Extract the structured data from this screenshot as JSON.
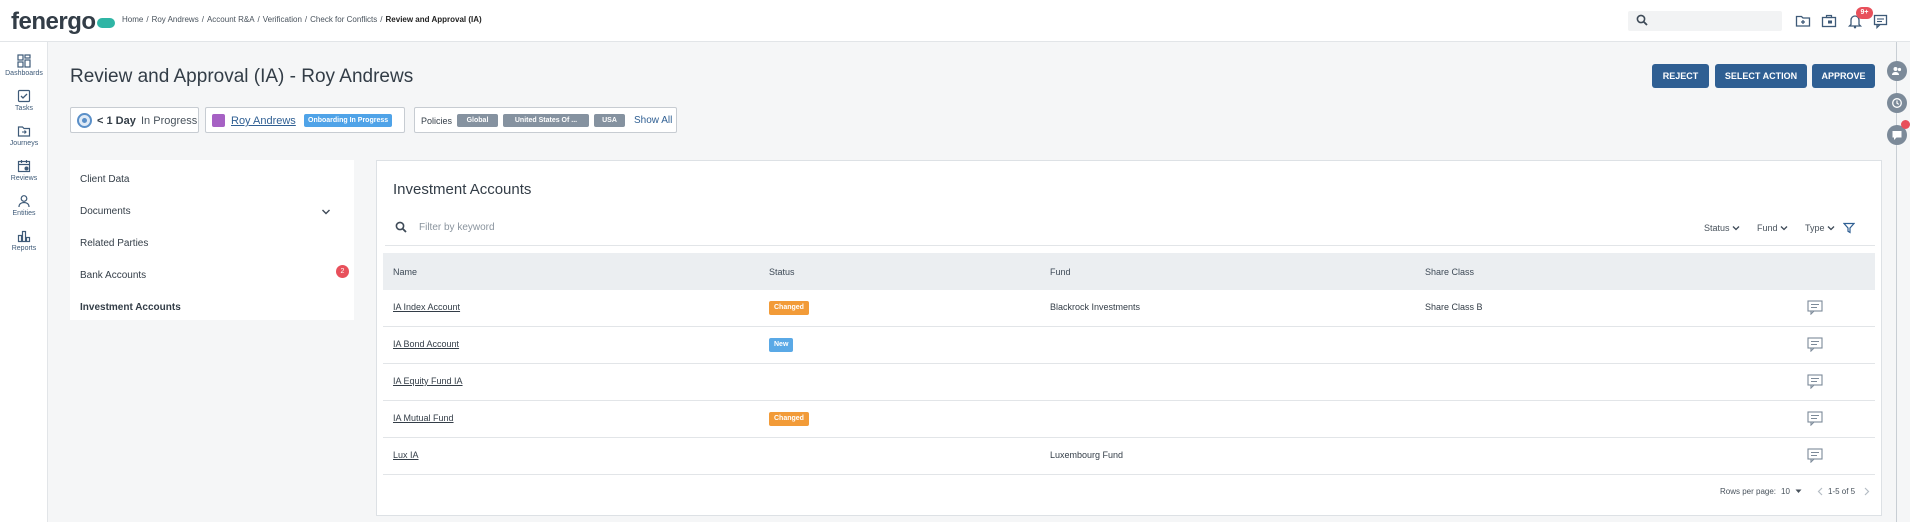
{
  "brand": {
    "logo_text": "fenergo",
    "accent": "#2fb5a5"
  },
  "breadcrumb": [
    {
      "label": "Home"
    },
    {
      "label": "Roy Andrews"
    },
    {
      "label": "Account R&A"
    },
    {
      "label": "Verification"
    },
    {
      "label": "Check for Conflicts"
    },
    {
      "label": "Review and Approval (IA)",
      "current": true
    }
  ],
  "breadcrumb_sep": "/",
  "topbar": {
    "search_placeholder": "",
    "notification_count": "9+",
    "icons": [
      "search-icon",
      "folder-add-icon",
      "briefcase-icon",
      "bell-icon",
      "chat-icon"
    ]
  },
  "nav": [
    {
      "label": "Dashboards",
      "icon": "grid-icon"
    },
    {
      "label": "Tasks",
      "icon": "checkbox-icon"
    },
    {
      "label": "Journeys",
      "icon": "journey-icon"
    },
    {
      "label": "Reviews",
      "icon": "calendar-icon"
    },
    {
      "label": "Entities",
      "icon": "person-icon"
    },
    {
      "label": "Reports",
      "icon": "bar-chart-icon"
    }
  ],
  "page": {
    "title": "Review and Approval (IA) - Roy Andrews",
    "actions": {
      "reject": "REJECT",
      "select_action": "SELECT ACTION",
      "approve": "APPROVE"
    },
    "action_color": "#2f5f93"
  },
  "info": {
    "duration": "< 1 Day",
    "duration_status": "In Progress",
    "entity_name": "Roy Andrews",
    "entity_status": "Onboarding In Progress",
    "entity_status_color": "#4fa3e8",
    "policies_label": "Policies",
    "policies": [
      "Global",
      "United States Of ...",
      "USA"
    ],
    "show_all": "Show All"
  },
  "side_menu": {
    "items": [
      {
        "label": "Client Data"
      },
      {
        "label": "Documents",
        "expandable": true
      },
      {
        "label": "Related Parties"
      },
      {
        "label": "Bank Accounts",
        "badge": "2"
      },
      {
        "label": "Investment Accounts",
        "active": true
      }
    ]
  },
  "investment": {
    "title": "Investment Accounts",
    "filter_placeholder": "Filter by keyword",
    "dropdowns": {
      "status": "Status",
      "fund": "Fund",
      "type": "Type"
    },
    "columns": {
      "name": "Name",
      "status": "Status",
      "fund": "Fund",
      "share_class": "Share Class"
    },
    "rows": [
      {
        "name": "IA Index Account",
        "status": "Changed",
        "fund": "Blackrock Investments",
        "share_class": "Share Class B"
      },
      {
        "name": "IA Bond Account",
        "status": "New",
        "fund": "",
        "share_class": ""
      },
      {
        "name": "IA Equity Fund IA",
        "status": "",
        "fund": "",
        "share_class": ""
      },
      {
        "name": "IA Mutual Fund",
        "status": "Changed",
        "fund": "",
        "share_class": ""
      },
      {
        "name": "Lux IA",
        "status": "",
        "fund": "Luxembourg Fund",
        "share_class": ""
      }
    ],
    "status_colors": {
      "Changed": "#f29b38",
      "New": "#5aa9e6"
    },
    "pager": {
      "rows_per_page_label": "Rows per page:",
      "rows_per_page": "10",
      "range": "1-5 of 5"
    }
  }
}
